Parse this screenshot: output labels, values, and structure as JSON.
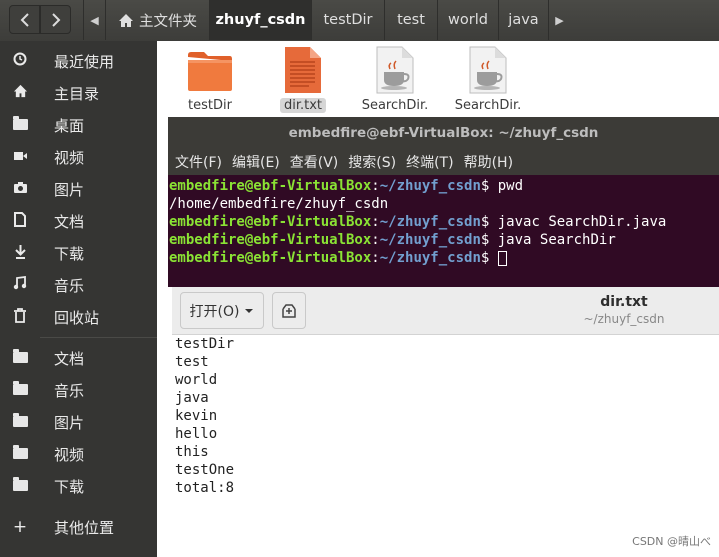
{
  "file_manager": {
    "path": [
      "主文件夹",
      "zhuyf_csdn",
      "testDir",
      "test",
      "world",
      "java"
    ],
    "active_crumb": 1,
    "icons": {
      "back": "chevron-left-icon",
      "forward": "chevron-right-icon",
      "path_left": "chevron-left-icon",
      "home": "home-icon",
      "path_right": "chevron-right-icon"
    },
    "sidebar": [
      {
        "label": "最近使用",
        "icon": "clock-icon"
      },
      {
        "label": "主目录",
        "icon": "home-icon"
      },
      {
        "label": "桌面",
        "icon": "folder-icon"
      },
      {
        "label": "视频",
        "icon": "video-icon"
      },
      {
        "label": "图片",
        "icon": "camera-icon"
      },
      {
        "label": "文档",
        "icon": "document-icon"
      },
      {
        "label": "下载",
        "icon": "download-icon"
      },
      {
        "label": "音乐",
        "icon": "music-icon"
      },
      {
        "label": "回收站",
        "icon": "trash-icon"
      },
      {
        "label": "文档",
        "icon": "folder-icon"
      },
      {
        "label": "音乐",
        "icon": "folder-icon"
      },
      {
        "label": "图片",
        "icon": "folder-icon"
      },
      {
        "label": "视频",
        "icon": "folder-icon"
      },
      {
        "label": "下载",
        "icon": "folder-icon"
      },
      {
        "label": "其他位置",
        "icon": "plus-icon"
      }
    ],
    "files": [
      {
        "name": "testDir",
        "icon": "folder-icon",
        "selected": false
      },
      {
        "name": "dir.txt",
        "icon": "text-file-icon",
        "selected": true
      },
      {
        "name": "SearchDir.",
        "icon": "java-file-icon",
        "selected": false
      },
      {
        "name": "SearchDir.",
        "icon": "java-file-icon",
        "selected": false
      }
    ]
  },
  "terminal": {
    "title": "embedfire@ebf-VirtualBox: ~/zhuyf_csdn",
    "menu": [
      "文件(F)",
      "编辑(E)",
      "查看(V)",
      "搜索(S)",
      "终端(T)",
      "帮助(H)"
    ],
    "lines": [
      {
        "user": "embedfire@ebf-VirtualBox",
        "sep": ":",
        "path": "~/zhuyf_csdn",
        "prompt": "$ ",
        "cmd": "pwd"
      },
      {
        "output": "/home/embedfire/zhuyf_csdn"
      },
      {
        "user": "embedfire@ebf-VirtualBox",
        "sep": ":",
        "path": "~/zhuyf_csdn",
        "prompt": "$ ",
        "cmd": "javac SearchDir.java"
      },
      {
        "user": "embedfire@ebf-VirtualBox",
        "sep": ":",
        "path": "~/zhuyf_csdn",
        "prompt": "$ ",
        "cmd": "java SearchDir"
      },
      {
        "user": "embedfire@ebf-VirtualBox",
        "sep": ":",
        "path": "~/zhuyf_csdn",
        "prompt": "$ ",
        "cmd": "",
        "cursor": true
      }
    ]
  },
  "editor": {
    "open_label": "打开(O)",
    "title": "dir.txt",
    "subtitle": "~/zhuyf_csdn",
    "lines": [
      "testDir",
      "test",
      "world",
      "java",
      "kevin",
      "hello",
      "this",
      "testOne",
      "total:8"
    ]
  },
  "watermark": "CSDN @晴山べ",
  "colors": {
    "terminal_bg": "#300a24",
    "term_user": "#8ae234",
    "term_path": "#729fcf",
    "sidebar_bg": "#353533",
    "folder_orange": "#f07a3e"
  }
}
